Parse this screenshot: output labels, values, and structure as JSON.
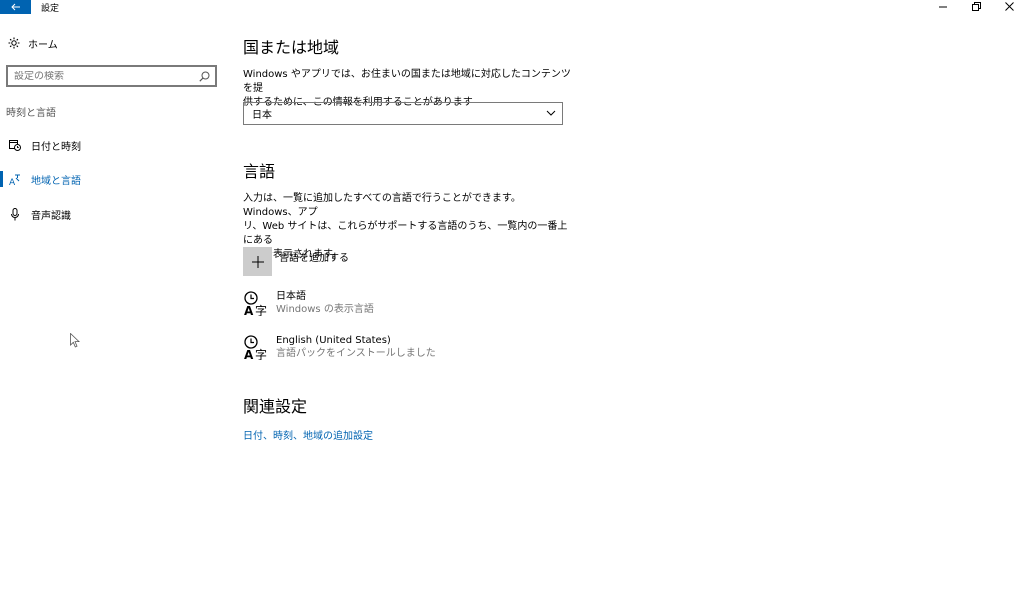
{
  "window": {
    "title": "設定"
  },
  "sidebar": {
    "home_label": "ホーム",
    "search_placeholder": "設定の検索",
    "group_label": "時刻と言語",
    "items": [
      {
        "label": "日付と時刻",
        "icon": "calendar-clock-icon"
      },
      {
        "label": "地域と言語",
        "icon": "region-language-icon",
        "active": true
      },
      {
        "label": "音声認識",
        "icon": "microphone-icon"
      }
    ]
  },
  "region": {
    "heading": "国または地域",
    "description_line1": "Windows やアプリでは、お住まいの国または地域に対応したコンテンツを提",
    "description_line2": "供するために、この情報を利用することがあります",
    "selected_country": "日本"
  },
  "languages": {
    "heading": "言語",
    "description_line1": "入力は、一覧に追加したすべての言語で行うことができます。Windows、アプ",
    "description_line2": "リ、Web サイトは、これらがサポートする言語のうち、一覧内の一番上にある",
    "description_line3": "言語で表示されます。",
    "add_label": "言語を追加する",
    "items": [
      {
        "name": "日本語",
        "status": "Windows の表示言語"
      },
      {
        "name": "English (United States)",
        "status": "言語パックをインストールしました"
      }
    ]
  },
  "related": {
    "heading": "関連設定",
    "link": "日付、時刻、地域の追加設定"
  },
  "colors": {
    "accent": "#0063b1",
    "secondary_text": "#767676"
  }
}
